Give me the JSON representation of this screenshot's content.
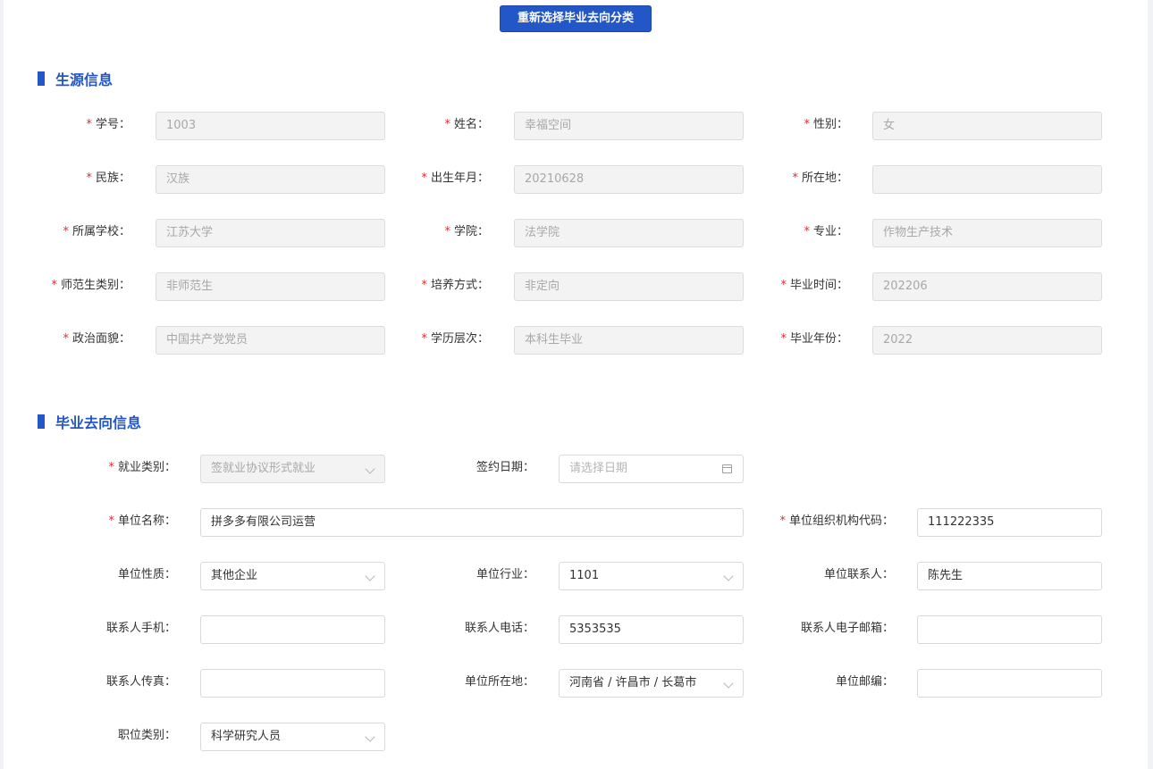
{
  "top_button": "重新选择毕业去向分类",
  "section1": {
    "title": "生源信息",
    "fields": [
      {
        "label": "学号",
        "value": "1003"
      },
      {
        "label": "姓名",
        "value": "幸福空间"
      },
      {
        "label": "性别",
        "value": "女"
      },
      {
        "label": "民族",
        "value": "汉族"
      },
      {
        "label": "出生年月",
        "value": "20210628"
      },
      {
        "label": "所在地",
        "value": ""
      },
      {
        "label": "所属学校",
        "value": "江苏大学"
      },
      {
        "label": "学院",
        "value": "法学院"
      },
      {
        "label": "专业",
        "value": "作物生产技术"
      },
      {
        "label": "师范生类别",
        "value": "非师范生"
      },
      {
        "label": "培养方式",
        "value": "非定向"
      },
      {
        "label": "毕业时间",
        "value": "202206"
      },
      {
        "label": "政治面貌",
        "value": "中国共产党党员"
      },
      {
        "label": "学历层次",
        "value": "本科生毕业"
      },
      {
        "label": "毕业年份",
        "value": "2022"
      }
    ]
  },
  "section2": {
    "title": "毕业去向信息",
    "employment_type": {
      "label": "就业类别",
      "value": "签就业协议形式就业"
    },
    "sign_date": {
      "label": "签约日期",
      "placeholder": "请选择日期"
    },
    "company_name": {
      "label": "单位名称",
      "value": "拼多多有限公司运营"
    },
    "org_code": {
      "label": "单位组织机构代码",
      "value": "111222335"
    },
    "company_nature": {
      "label": "单位性质",
      "value": "其他企业"
    },
    "industry": {
      "label": "单位行业",
      "value": "1101"
    },
    "contact_person": {
      "label": "单位联系人",
      "value": "陈先生"
    },
    "contact_mobile": {
      "label": "联系人手机",
      "value": ""
    },
    "contact_phone": {
      "label": "联系人电话",
      "value": "5353535"
    },
    "contact_email": {
      "label": "联系人电子邮箱",
      "value": ""
    },
    "contact_fax": {
      "label": "联系人传真",
      "value": ""
    },
    "company_location": {
      "label": "单位所在地",
      "value": "河南省 / 许昌市 / 长葛市"
    },
    "postcode": {
      "label": "单位邮编",
      "value": ""
    },
    "job_category": {
      "label": "职位类别",
      "value": "科学研究人员"
    }
  },
  "colors": {
    "accent": "#2356c7",
    "required": "#e02d2d",
    "disabled_bg": "#f3f3f3"
  }
}
